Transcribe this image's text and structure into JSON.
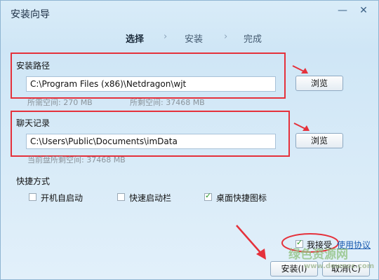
{
  "window": {
    "title": "安装向导"
  },
  "controls": {
    "minimize": "—",
    "close": "✕"
  },
  "steps": [
    {
      "label": "选择",
      "active": true
    },
    {
      "label": "安装",
      "active": false
    },
    {
      "label": "完成",
      "active": false
    }
  ],
  "step_separator": "›",
  "install_path": {
    "label": "安装路径",
    "value": "C:\\Program Files (x86)\\Netdragon\\wjt",
    "browse": "浏览",
    "required_space": "所需空间: 270 MB",
    "free_space": "所剩空间: 37468 MB"
  },
  "chat_log": {
    "label": "聊天记录",
    "value": "C:\\Users\\Public\\Documents\\imData",
    "browse": "浏览",
    "free_space": "当前盘所剩空间: 37468 MB"
  },
  "shortcuts": {
    "label": "快捷方式",
    "options": [
      {
        "label": "开机自启动",
        "checked": false
      },
      {
        "label": "快速启动栏",
        "checked": false
      },
      {
        "label": "桌面快捷图标",
        "checked": true
      }
    ]
  },
  "agreement": {
    "accept_label": "我接受",
    "accepted": true,
    "link": "使用协议"
  },
  "footer": {
    "install": "安装(I)",
    "cancel": "取消(C)"
  },
  "watermark": {
    "text": "绿色资源网",
    "url": "www.downcc.com"
  },
  "annotation_color": "#e5313b",
  "check_color": "#2b9a2b"
}
